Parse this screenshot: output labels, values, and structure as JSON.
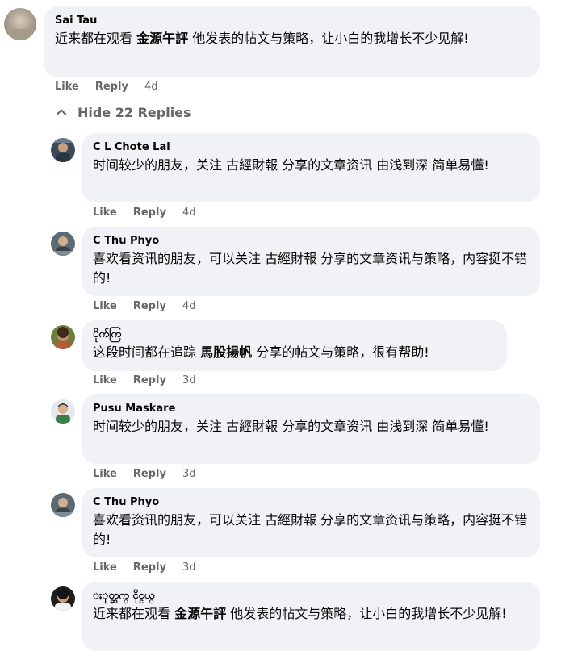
{
  "thread": {
    "hide_replies_label": "Hide 22 Replies"
  },
  "comments": [
    {
      "author": "Sai Tau",
      "text_before": "近来都在观看 ",
      "highlight": "金源午評",
      "text_after": " 他发表的帖文与策略，让小白的我增长不少见解!",
      "like": "Like",
      "reply": "Reply",
      "time": "4d"
    },
    {
      "author": "C L Chote Lal",
      "text_before": "时间较少的朋友，关注 古經財報 分享的文章资讯 由浅到深 简单易懂!",
      "highlight": "",
      "text_after": "",
      "like": "Like",
      "reply": "Reply",
      "time": "4d"
    },
    {
      "author": "C Thu Phyo",
      "text_before": "喜欢看资讯的朋友，可以关注 古經財報 分享的文章资讯与策略，内容挺不错的!",
      "highlight": "",
      "text_after": "",
      "like": "Like",
      "reply": "Reply",
      "time": "4d"
    },
    {
      "author": "ပိုက်ကြ",
      "text_before": "这段时间都在追踪 ",
      "highlight": "馬股揚帆",
      "text_after": " 分享的帖文与策略，很有帮助!",
      "like": "Like",
      "reply": "Reply",
      "time": "3d"
    },
    {
      "author": "Pusu Maskare",
      "text_before": "时间较少的朋友，关注 古經財報 分享的文章资讯 由浅到深 简单易懂!",
      "highlight": "",
      "text_after": "",
      "like": "Like",
      "reply": "Reply",
      "time": "3d"
    },
    {
      "author": "C Thu Phyo",
      "text_before": "喜欢看资讯的朋友，可以关注 古經財報 分享的文章资讯与策略，内容挺不错的!",
      "highlight": "",
      "text_after": "",
      "like": "Like",
      "reply": "Reply",
      "time": "3d"
    },
    {
      "author": "ႏုတ္ဆက္ ငိုင္ငယ္",
      "text_before": "近来都在观看 ",
      "highlight": "金源午評",
      "text_after": " 他发表的帖文与策略，让小白的我增长不少见解!",
      "like": "",
      "reply": "",
      "time": ""
    }
  ],
  "colors": {
    "bubble_bg": "#f0f2f5",
    "meta_text": "#65676b",
    "primary_text": "#050505"
  },
  "icons": {
    "hide_replies": "chevron-up-icon",
    "avatar": "user-avatar-photo"
  }
}
